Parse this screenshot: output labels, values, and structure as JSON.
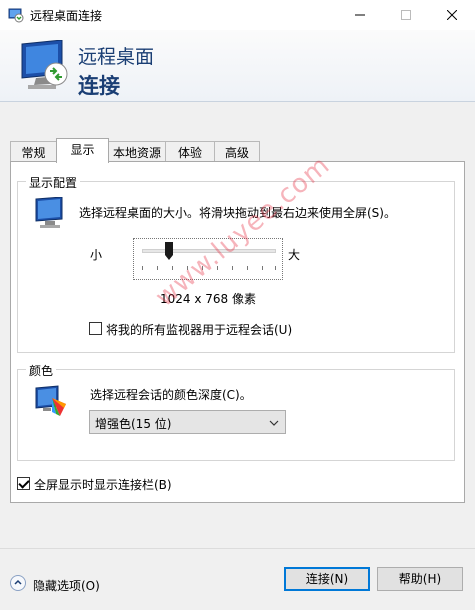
{
  "window": {
    "title": "远程桌面连接",
    "minimize": "—",
    "maximize": "☐",
    "close": "✕"
  },
  "banner": {
    "line1": "远程桌面",
    "line2": "连接"
  },
  "tabs": [
    {
      "label": "常规"
    },
    {
      "label": "显示",
      "active": true
    },
    {
      "label": "本地资源"
    },
    {
      "label": "体验"
    },
    {
      "label": "高级"
    }
  ],
  "display_config": {
    "title": "显示配置",
    "description": "选择远程桌面的大小。将滑块拖动到最右边来使用全屏(S)。",
    "small_label": "小",
    "large_label": "大",
    "resolution": "1024 x 768 像素",
    "multi_monitor_label": "将我的所有监视器用于远程会话(U)",
    "multi_monitor_checked": false
  },
  "colors": {
    "title": "颜色",
    "description": "选择远程会话的颜色深度(C)。",
    "selected": "增强色(15 位)"
  },
  "fullscreen_bar": {
    "label": "全屏显示时显示连接栏(B)",
    "checked": true
  },
  "footer": {
    "hide_options": "隐藏选项(O)",
    "connect": "连接(N)",
    "help": "帮助(H)"
  },
  "watermark": "www.luyee.com",
  "theme": {
    "accent": "#0078d7",
    "banner_text": "#1a3e74"
  }
}
